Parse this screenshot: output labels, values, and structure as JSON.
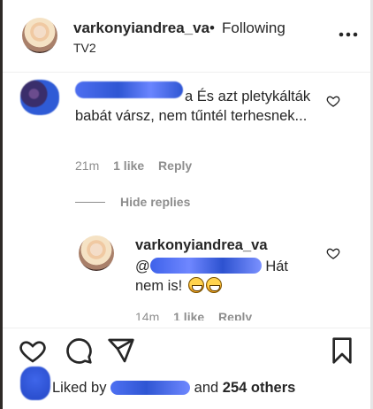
{
  "header": {
    "username": "varkonyiandrea_va",
    "separator": "•",
    "follow_status": "Following",
    "subtitle": "TV2",
    "more_icon": "more-horizontal-icon"
  },
  "comment": {
    "text_visible": "a És azt pletykálták babát vársz, nem tűntél terhesnek...",
    "time": "21m",
    "likes": "1 like",
    "reply": "Reply"
  },
  "replies": {
    "hide_label": "Hide replies"
  },
  "reply_comment": {
    "username": "varkonyiandrea_va",
    "mention_prefix": "@",
    "text": "Hát nem is!",
    "time": "14m",
    "likes": "1 like",
    "reply": "Reply"
  },
  "actions": {
    "like_icon": "heart-icon",
    "comment_icon": "comment-icon",
    "share_icon": "send-icon",
    "save_icon": "bookmark-icon"
  },
  "likes": {
    "prefix": "Liked by",
    "middle": "and",
    "others": "254 others"
  },
  "colors": {
    "text": "#262626",
    "muted": "#8e8e8e",
    "redaction_blue": "#2f5bd6"
  }
}
